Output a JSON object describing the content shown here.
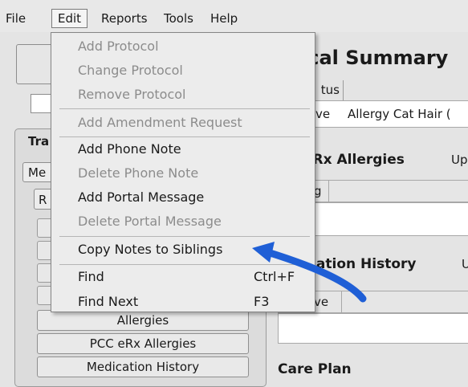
{
  "menubar": {
    "file": "File",
    "edit": "Edit",
    "reports": "Reports",
    "tools": "Tools",
    "help": "Help"
  },
  "left_panel": {
    "section_label": "Tra",
    "me_button": "Me",
    "r_button": "R",
    "buttons": {
      "allergies": "Allergies",
      "pcc_erx_allergies": "PCC eRx Allergies",
      "medication_history": "Medication History"
    }
  },
  "right_panel": {
    "title": "ical Summary",
    "tab_stub": "tus",
    "allergy_row": {
      "status": "ve",
      "text": "Allergy Cat Hair ("
    },
    "erx_allergies": {
      "title": "eRx Allergies",
      "tail": "Up",
      "header_stub": "g"
    },
    "medication_history": {
      "title": "ication History",
      "tail": "U",
      "header_stub": "ve"
    },
    "care_plan": {
      "title": "Care Plan"
    }
  },
  "edit_menu": {
    "items": [
      {
        "label": "Add Protocol",
        "enabled": false
      },
      {
        "label": "Change Protocol",
        "enabled": false
      },
      {
        "label": "Remove Protocol",
        "enabled": false
      },
      {
        "label": "Add Amendment Request",
        "enabled": false
      },
      {
        "label": "Add Phone Note",
        "enabled": true
      },
      {
        "label": "Delete Phone Note",
        "enabled": false
      },
      {
        "label": "Add Portal Message",
        "enabled": true
      },
      {
        "label": "Delete Portal Message",
        "enabled": false
      },
      {
        "label": "Copy Notes to Siblings",
        "enabled": true
      },
      {
        "label": "Find",
        "enabled": true,
        "shortcut": "Ctrl+F"
      },
      {
        "label": "Find Next",
        "enabled": true,
        "shortcut": "F3"
      }
    ]
  },
  "annotation": {
    "arrow_color": "#1f5fd6"
  }
}
